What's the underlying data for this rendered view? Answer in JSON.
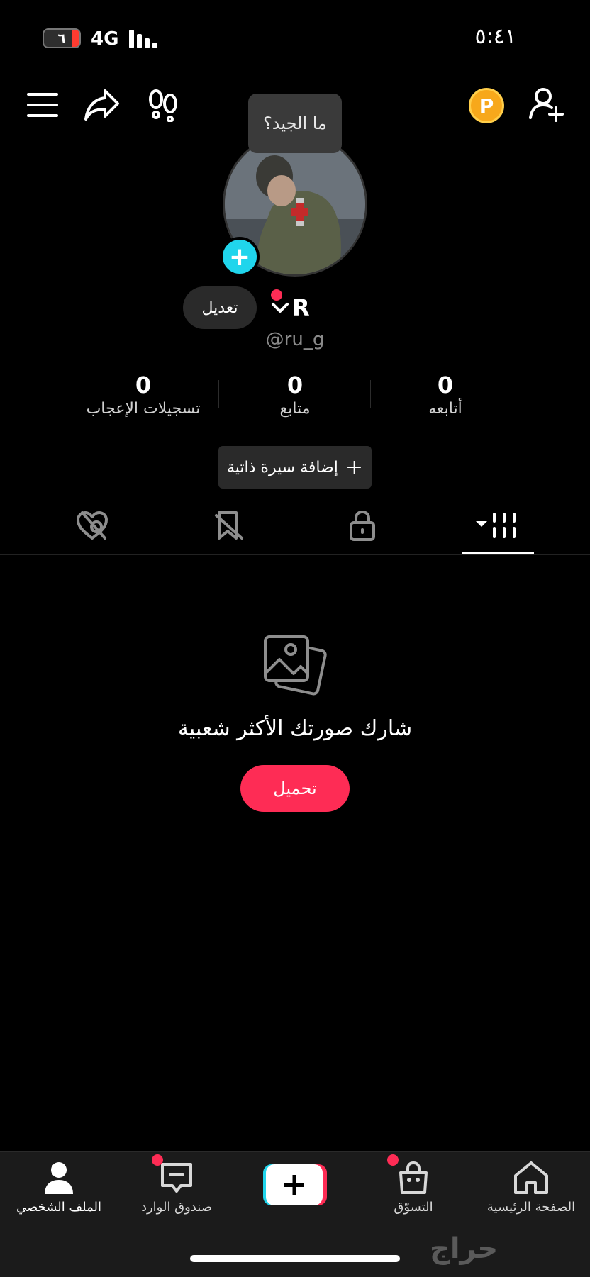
{
  "status_bar": {
    "time": "٥:٤١",
    "battery": "٦",
    "network": "4G"
  },
  "header": {
    "coin_label": "P"
  },
  "tooltip": {
    "text": "ما الجيد؟"
  },
  "profile": {
    "edit_label": "تعديل",
    "display_name": "R",
    "username": "@ru_g"
  },
  "stats": [
    {
      "value": "0",
      "label": "أتابعه"
    },
    {
      "value": "0",
      "label": "متابع"
    },
    {
      "value": "0",
      "label": "تسجيلات الإعجاب"
    }
  ],
  "bio_button": {
    "icon": "+",
    "label": "إضافة سيرة ذاتية"
  },
  "tabs": [
    {
      "name": "videos-grid",
      "active": true
    },
    {
      "name": "private",
      "active": false
    },
    {
      "name": "saved-hidden",
      "active": false
    },
    {
      "name": "liked-hidden",
      "active": false
    }
  ],
  "empty_state": {
    "text": "شارك صورتك الأكثر شعبية",
    "upload_label": "تحميل"
  },
  "bottom_nav": {
    "home": "الصفحة الرئيسية",
    "shop": "التسوّق",
    "inbox": "صندوق الوارد",
    "profile": "الملف الشخصي"
  },
  "watermark": "حراج",
  "colors": {
    "accent": "#fe2c55",
    "cyan": "#20d5ec",
    "coin": "#f7a81b",
    "background": "#000000"
  }
}
